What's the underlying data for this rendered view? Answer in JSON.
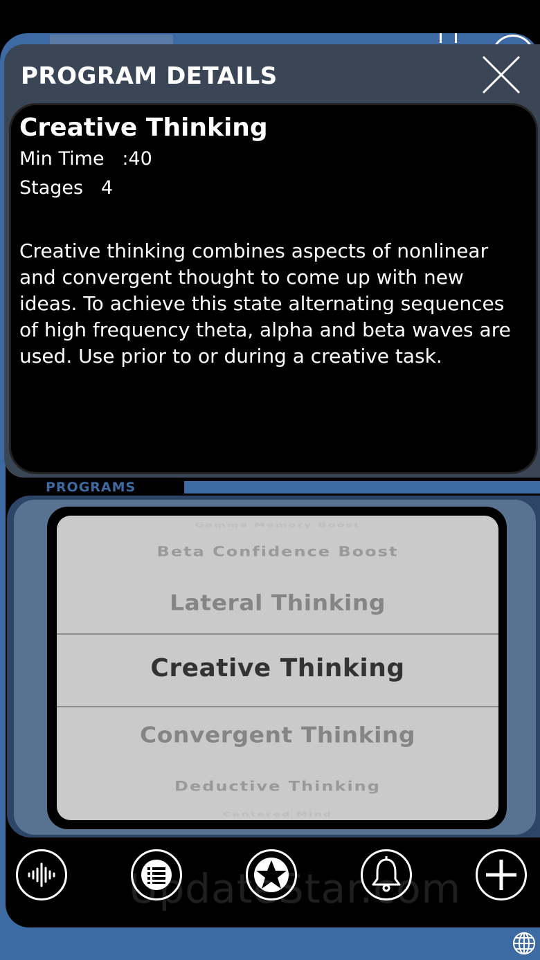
{
  "modal": {
    "title": "PROGRAM DETAILS",
    "program_name": "Creative Thinking",
    "min_time": "Min Time   :40",
    "stages": "Stages   4",
    "description": "Creative thinking combines aspects of nonlinear and convergent thought to come up with new ideas.  To achieve this state alternating sequences of high frequency theta, alpha and beta waves are used.  Use prior to or during a creative task."
  },
  "programs": {
    "label": "PROGRAMS",
    "picker_items": [
      {
        "label": "Gamma Memory Boost",
        "state": "far"
      },
      {
        "label": "Beta Confidence Boost",
        "state": "near"
      },
      {
        "label": "Lateral Thinking",
        "state": "adjacent"
      },
      {
        "label": "Creative Thinking",
        "state": "selected"
      },
      {
        "label": "Convergent Thinking",
        "state": "adjacent"
      },
      {
        "label": "Deductive Thinking",
        "state": "near"
      },
      {
        "label": "Centered Mind",
        "state": "far"
      }
    ]
  },
  "toolbar": {
    "icons": [
      "waveform-icon",
      "list-icon",
      "star-icon",
      "bell-icon",
      "plus-icon"
    ]
  },
  "watermark": "UpdateStar.com",
  "colors": {
    "accent_blue": "#3d6aa3",
    "modal_frame": "#3a4656",
    "picker_bg": "#cacaca",
    "selected_text": "#333333"
  }
}
